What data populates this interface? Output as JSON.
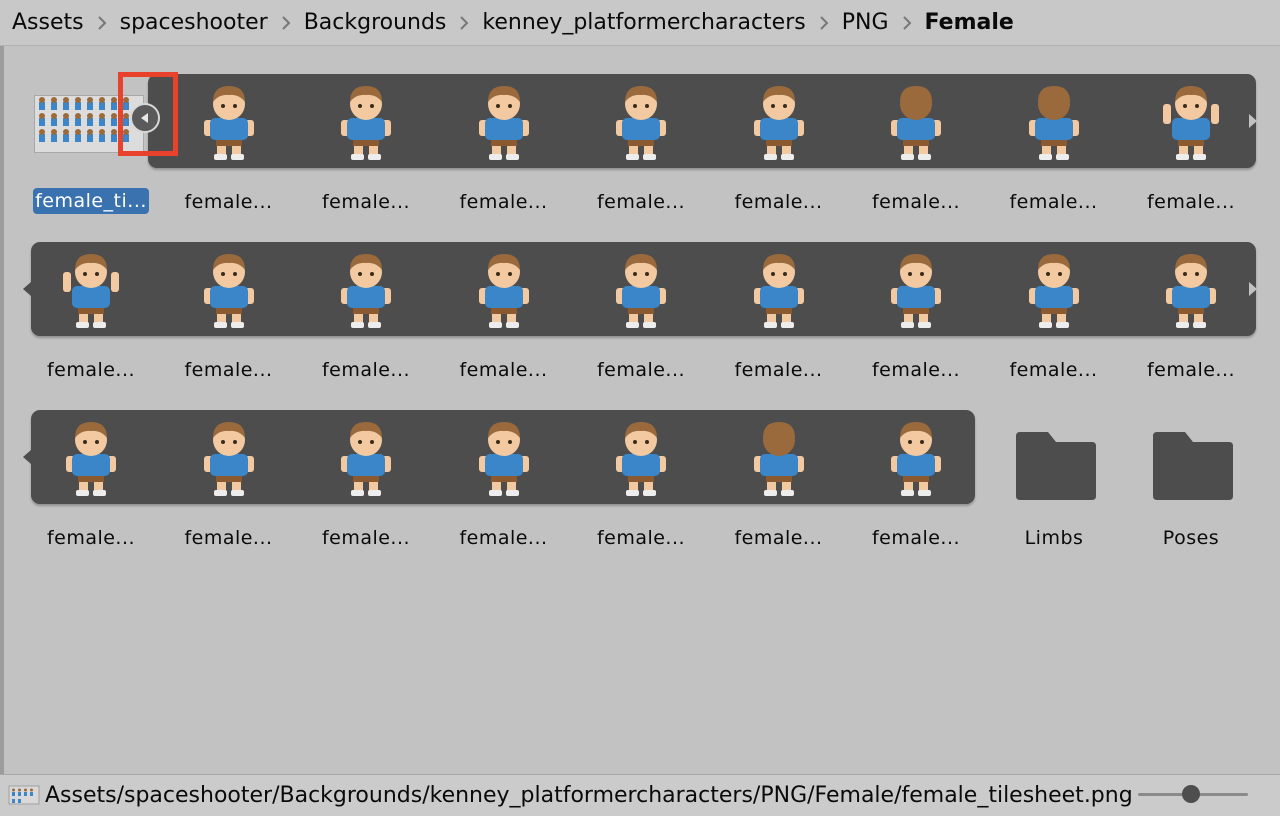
{
  "breadcrumb": {
    "items": [
      "Assets",
      "spaceshooter",
      "Backgrounds",
      "kenney_platformercharacters",
      "PNG"
    ],
    "current": "Female"
  },
  "assets": {
    "tilesheet_label": "female_ti...",
    "sprite_label": "female...",
    "folders": [
      "Limbs",
      "Poses"
    ]
  },
  "statusbar": {
    "path": "Assets/spaceshooter/Backgrounds/kenney_platformercharacters/PNG/Female/female_tilesheet.png",
    "zoom": 0.48
  },
  "colors": {
    "selection": "#3a72b0",
    "strip": "#4d4d4d",
    "highlight": "#e8412c",
    "shirt": "#3a86c8",
    "skin": "#f2c9a0",
    "hair": "#9a6a3c",
    "pants": "#8c5a30"
  }
}
